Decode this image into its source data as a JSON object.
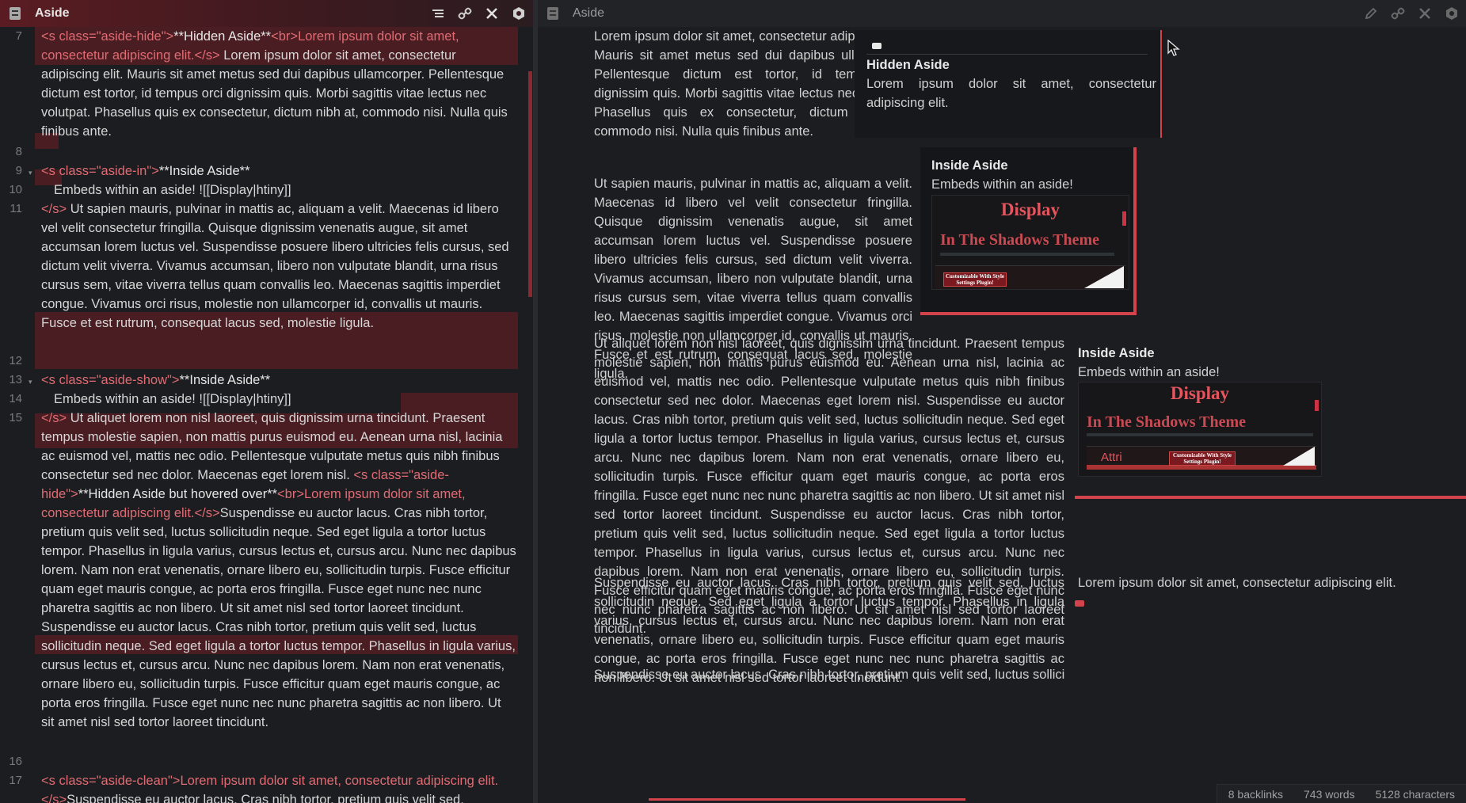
{
  "left_pane": {
    "title": "Aside",
    "header_icons": [
      "reading-view-icon",
      "link-icon",
      "close-icon",
      "hexagon-icon"
    ],
    "lines": [
      {
        "num": "7"
      },
      {
        "num": "8"
      },
      {
        "num": "9"
      },
      {
        "num": "10"
      },
      {
        "num": "11"
      },
      {
        "num": "12"
      },
      {
        "num": "13"
      },
      {
        "num": "14"
      },
      {
        "num": "15"
      },
      {
        "num": "16"
      },
      {
        "num": "17"
      }
    ],
    "l7_tag": "<s class=\"aside-hide\">",
    "l7_bold": "**Hidden Aside**",
    "l7_br": "<br>",
    "l7_tagged": "Lorem ipsum dolor sit amet, consectetur adipiscing elit.",
    "l7_close": "</s>",
    "l7_rest": " Lorem ipsum dolor sit amet, consectetur adipiscing elit. Mauris sit amet metus sed dui dapibus ullamcorper. Pellentesque dictum est tortor, id tempus orci dignissim quis. Morbi sagittis vitae lectus nec volutpat. Phasellus quis ex consectetur, dictum nibh at, commodo nisi. Nulla quis finibus ante.",
    "l9_tag": "<s class=\"aside-in\">",
    "l9_bold": "**Inside Aside**",
    "l10": "Embeds within an aside! ![[Display|htiny]]",
    "l11_close": "</s>",
    "l11_rest": " Ut sapien mauris, pulvinar in mattis ac, aliquam a velit. Maecenas id libero vel velit consectetur fringilla. Quisque dignissim venenatis augue, sit amet accumsan lorem luctus vel. Suspendisse posuere libero ultricies felis cursus, sed dictum velit viverra. Vivamus accumsan, libero non vulputate blandit, urna risus cursus sem, vitae viverra tellus quam convallis leo. Maecenas sagittis imperdiet congue. Vivamus orci risus, molestie non ullamcorper id, convallis ut mauris. Fusce et est rutrum, consequat lacus sed, molestie ligula.",
    "l13_tag": "<s class=\"aside-show\">",
    "l13_bold": "**Inside Aside**",
    "l14": "Embeds within an aside! ![[Display|htiny]]",
    "l15_close": "</s>",
    "l15_a": " Ut aliquet lorem non nisl laoreet, quis dignissim urna tincidunt. Praesent tempus molestie sapien, non mattis purus euismod eu. Aenean urna nisl, lacinia ac euismod vel, mattis nec odio. Pellentesque vulputate metus quis nibh finibus consectetur sed nec dolor. Maecenas eget lorem nisl. ",
    "l15_tag": "<s class=\"aside-hide\">",
    "l15_bold": "**Hidden Aside but hovered over**",
    "l15_br": "<br>",
    "l15_tagged": "Lorem ipsum dolor sit amet, consectetur adipiscing elit.",
    "l15_close2": "</s>",
    "l15_rest": "Suspendisse eu auctor lacus. Cras nibh tortor, pretium quis velit sed, luctus sollicitudin neque. Sed eget ligula a tortor luctus tempor. Phasellus in ligula varius, cursus lectus et, cursus arcu. Nunc nec dapibus lorem. Nam non erat venenatis, ornare libero eu, sollicitudin turpis. Fusce efficitur quam eget mauris congue, ac porta eros fringilla. Fusce eget nunc nec nunc pharetra sagittis ac non libero. Ut sit amet nisl sed tortor laoreet tincidunt. Suspendisse eu auctor lacus. Cras nibh tortor, pretium quis velit sed, luctus sollicitudin neque. Sed eget ligula a tortor luctus tempor. Phasellus in ligula varius, cursus lectus et, cursus arcu. Nunc nec dapibus lorem. Nam non erat venenatis, ornare libero eu, sollicitudin turpis. Fusce efficitur quam eget mauris congue, ac porta eros fringilla. Fusce eget nunc nec nunc pharetra sagittis ac non libero. Ut sit amet nisl sed tortor laoreet tincidunt.",
    "l17_tag": "<s class=\"aside-clean\">",
    "l17_tagged": "Lorem ipsum dolor sit amet, consectetur adipiscing elit.",
    "l17_close": "</s>",
    "l17_rest": "Suspendisse eu auctor lacus. Cras nibh tortor, pretium quis velit sed,"
  },
  "right_pane": {
    "title": "Aside",
    "header_icons": [
      "edit-icon",
      "link-icon",
      "close-icon",
      "hexagon-icon"
    ],
    "p1": "Lorem ipsum dolor sit amet, consectetur adipiscing elit. Mauris sit amet metus sed dui dapibus ullamcorper. Pellentesque dictum est tortor, id tempus orci dignissim quis. Morbi sagittis vitae lectus nec volutpat. Phasellus quis ex consectetur, dictum nibh at, commodo nisi. Nulla quis finibus ante.",
    "hidden_aside_title": "Hidden Aside",
    "hidden_aside_text": "Lorem ipsum dolor sit amet, consectetur adipiscing elit.",
    "p2": "Ut sapien mauris, pulvinar in mattis ac, aliquam a velit. Maecenas id libero vel velit consectetur fringilla. Quisque dignissim venenatis augue, sit amet accumsan lorem luctus vel. Suspendisse posuere libero ultricies felis cursus, sed dictum velit viverra. Vivamus accumsan, libero non vulputate blandit, urna risus cursus sem, vitae viverra tellus quam convallis leo. Maecenas sagittis imperdiet congue. Vivamus orci risus, molestie non ullamcorper id, convallis ut mauris. Fusce et est rutrum, consequat lacus sed, molestie ligula.",
    "inside_aside_1_title": "Inside Aside",
    "inside_aside_1_text": "Embeds within an aside!",
    "embed_display": "Display",
    "embed_theme": "In The Shadows Theme",
    "embed_banner": "Customizable With Style Settings Plugin!",
    "p3": "Ut aliquet lorem non nisl laoreet, quis dignissim urna tincidunt. Praesent tempus molestie sapien, non mattis purus euismod eu. Aenean urna nisl, lacinia ac euismod vel, mattis nec odio. Pellentesque vulputate metus quis nibh finibus consectetur sed nec dolor. Maecenas eget lorem nisl. Suspendisse eu auctor lacus. Cras nibh tortor, pretium quis velit sed, luctus sollicitudin neque. Sed eget ligula a tortor luctus tempor. Phasellus in ligula varius, cursus lectus et, cursus arcu. Nunc nec dapibus lorem. Nam non erat venenatis, ornare libero eu, sollicitudin turpis. Fusce efficitur quam eget mauris congue, ac porta eros fringilla. Fusce eget nunc nec nunc pharetra sagittis ac non libero. Ut sit amet nisl sed tortor laoreet tincidunt. Suspendisse eu auctor lacus. Cras nibh tortor, pretium quis velit sed, luctus sollicitudin neque. Sed eget ligula a tortor luctus tempor. Phasellus in ligula varius, cursus lectus et, cursus arcu. Nunc nec dapibus lorem. Nam non erat venenatis, ornare libero eu, sollicitudin turpis. Fusce efficitur quam eget mauris congue, ac porta eros fringilla. Fusce eget nunc nec nunc pharetra sagittis ac non libero. Ut sit amet nisl sed tortor laoreet tincidunt.",
    "inside_aside_2_title": "Inside Aside",
    "inside_aside_2_text": "Embeds within an aside!",
    "embed2_overlay": "Attri",
    "p4": "Suspendisse eu auctor lacus. Cras nibh tortor, pretium quis velit sed, luctus sollicitudin neque. Sed eget ligula a tortor luctus tempor. Phasellus in ligula varius, cursus lectus et, cursus arcu. Nunc nec dapibus lorem. Nam non erat venenatis, ornare libero eu, sollicitudin turpis. Fusce efficitur quam eget mauris congue, ac porta eros fringilla. Fusce eget nunc nec nunc pharetra sagittis ac non libero. Ut sit amet nisl sed tortor laoreet tincidunt.",
    "clean_aside_text": "Lorem ipsum dolor sit amet, consectetur adipiscing elit.",
    "p5": "Suspendisse eu auctor lacus. Cras nibh tortor, pretium quis velit sed, luctus sollicitudin"
  },
  "status_bar": {
    "backlinks": "8 backlinks",
    "words": "743 words",
    "characters": "5128 characters"
  },
  "colors": {
    "accent": "#d2434c",
    "tag": "#e16b73",
    "highlight_bg": "#4a1d22",
    "background": "#1c1d20"
  }
}
